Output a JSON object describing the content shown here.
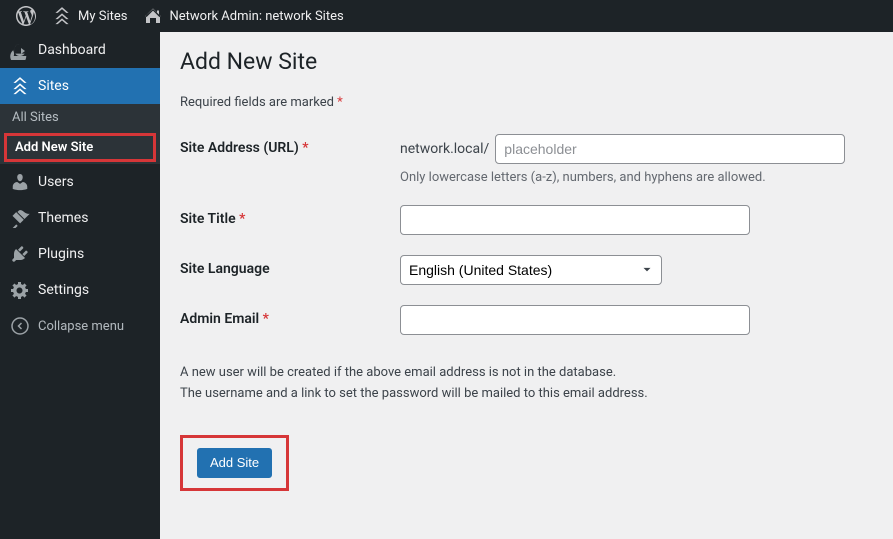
{
  "adminbar": {
    "my_sites": "My Sites",
    "network_admin": "Network Admin: network Sites"
  },
  "sidebar": {
    "dashboard": "Dashboard",
    "sites": "Sites",
    "submenu": {
      "all_sites": "All Sites",
      "add_new_site": "Add New Site"
    },
    "users": "Users",
    "themes": "Themes",
    "plugins": "Plugins",
    "settings": "Settings",
    "collapse": "Collapse menu"
  },
  "page": {
    "title": "Add New Site",
    "required_note": "Required fields are marked ",
    "url_label": "Site Address (URL) ",
    "url_prefix": "network.local/",
    "url_placeholder": "placeholder",
    "url_help": "Only lowercase letters (a-z), numbers, and hyphens are allowed.",
    "title_label": "Site Title ",
    "lang_label": "Site Language",
    "lang_value": "English (United States)",
    "email_label": "Admin Email ",
    "desc_line1": "A new user will be created if the above email address is not in the database.",
    "desc_line2": "The username and a link to set the password will be mailed to this email address.",
    "submit_label": "Add Site"
  }
}
